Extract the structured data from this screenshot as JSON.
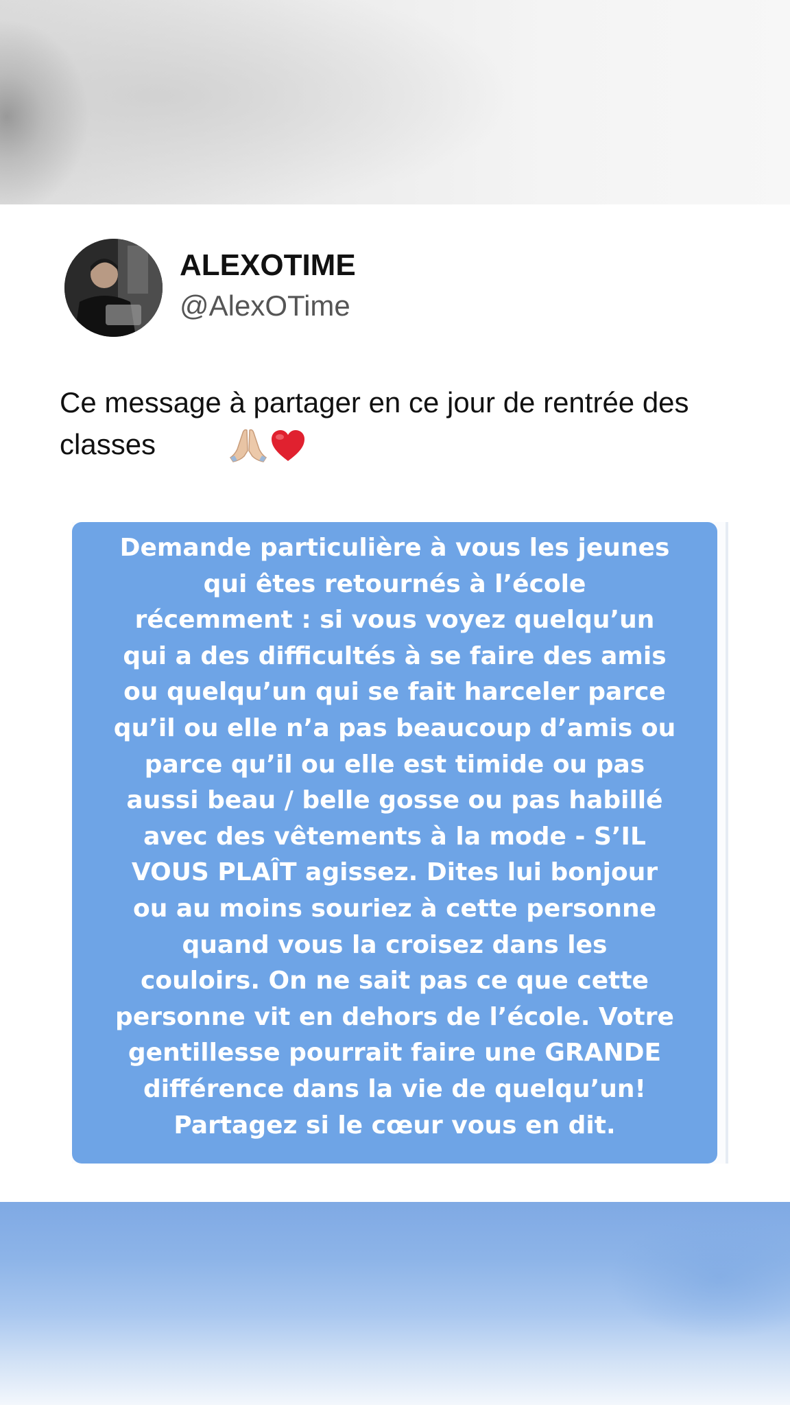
{
  "post": {
    "author": {
      "display_name": "ALEXOTIME",
      "handle": "@AlexOTime"
    },
    "text": "Ce message à partager en ce jour de rentrée des classes",
    "emojis": [
      "folded-hands-icon",
      "red-heart-icon"
    ],
    "image": {
      "background_color": "#6ea4e6",
      "text_lines": [
        "Demande particulière à vous les jeunes",
        "qui êtes retournés à l’école",
        "récemment : si vous voyez quelqu’un",
        "qui a des difficultés à se faire des amis",
        "ou quelqu’un qui se fait harceler parce",
        "qu’il ou elle n’a pas beaucoup d’amis ou",
        "parce qu’il ou elle est timide ou pas",
        "aussi beau / belle gosse ou pas habillé",
        "avec des vêtements à la mode - S’IL",
        "VOUS PLAÎT agissez. Dites lui bonjour",
        "ou au moins souriez à cette personne",
        "quand vous la croisez dans les",
        "couloirs. On ne sait pas ce que cette",
        "personne vit en dehors de l’école. Votre",
        "gentillesse pourrait faire une GRANDE",
        "différence dans la vie de quelqu’un!",
        "Partagez si le cœur vous en dit."
      ]
    }
  }
}
